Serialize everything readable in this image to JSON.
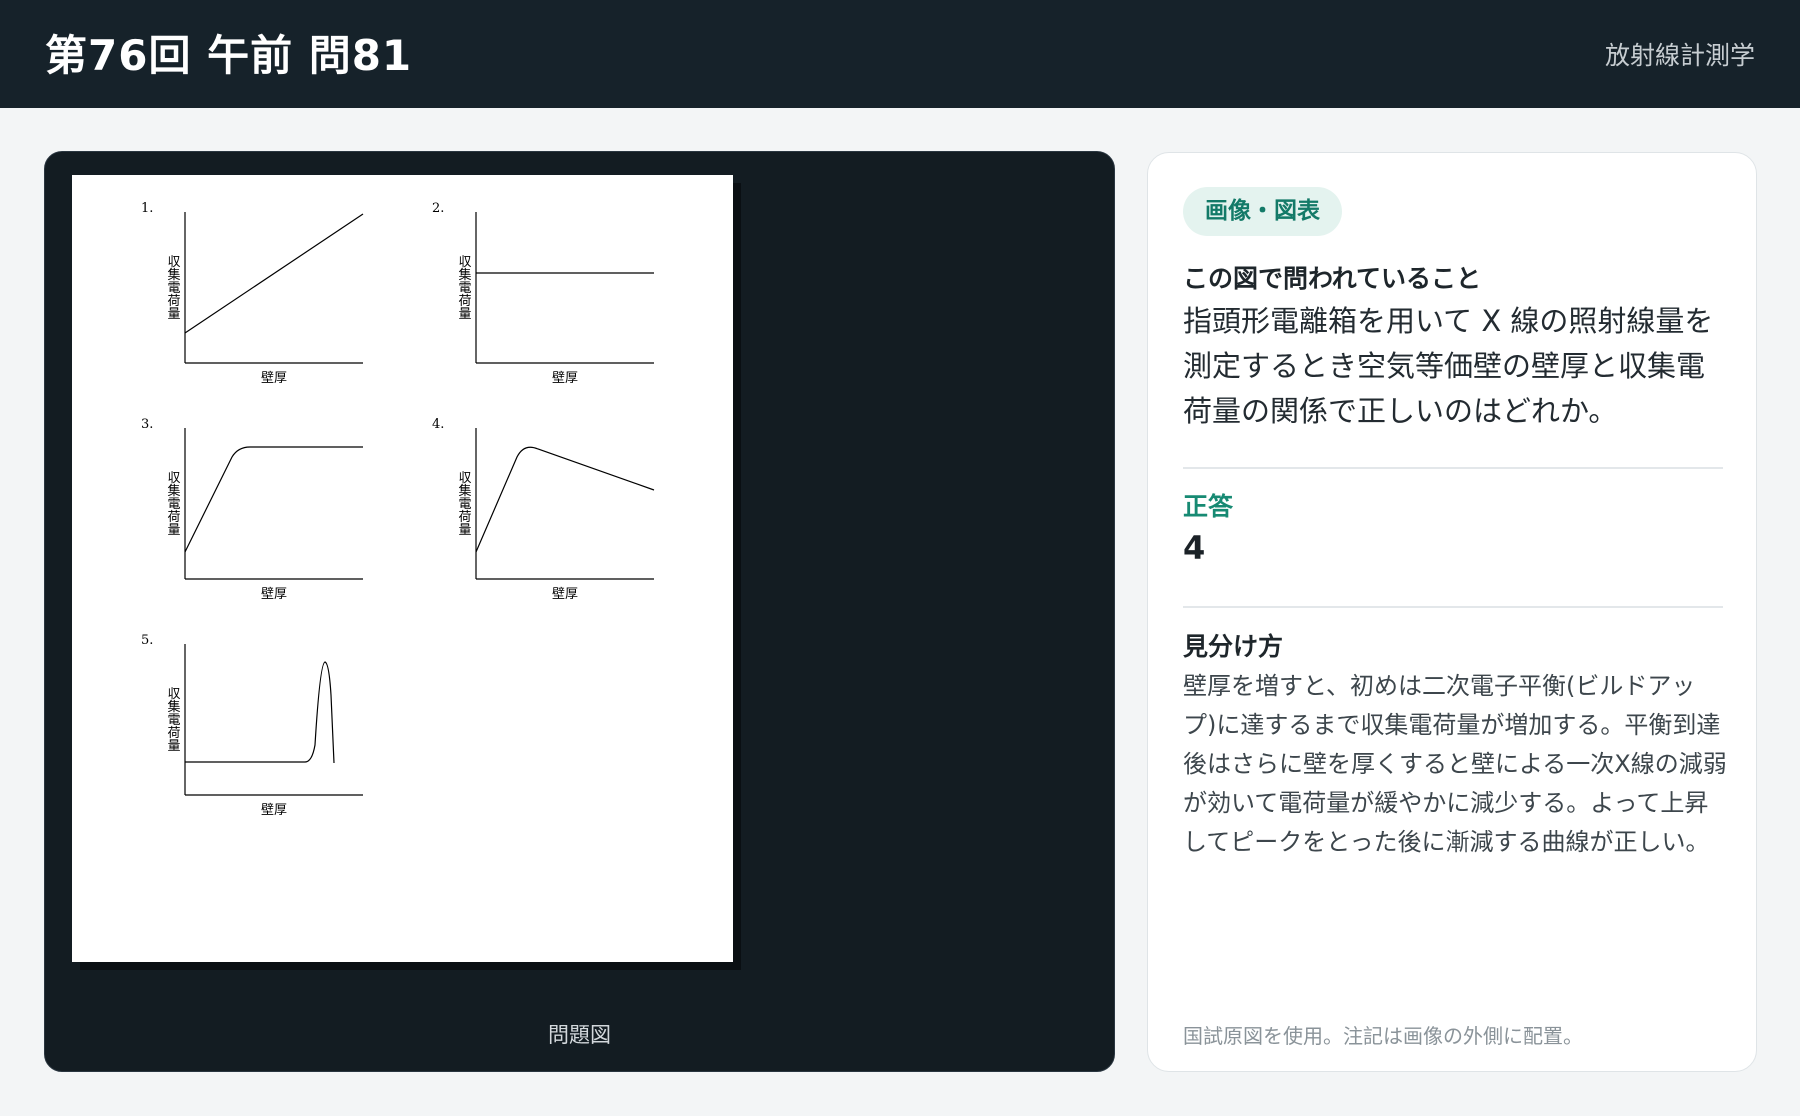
{
  "header": {
    "title": "第76回 午前 問81",
    "subject": "放射線計測学"
  },
  "figure": {
    "caption": "問題図",
    "graph_labels": {
      "ylabel": "収集電荷量",
      "xlabel": "壁厚"
    },
    "options": [
      "1.",
      "2.",
      "3.",
      "4.",
      "5."
    ]
  },
  "panel": {
    "tag": "画像・図表",
    "question_title": "この図で問われていること",
    "question_text": "指頭形電離箱を用いて X 線の照射線量を測定するとき空気等価壁の壁厚と収集電荷量の関係で正しいのはどれか。",
    "answer_label": "正答",
    "answer_value": "4",
    "explain_title": "見分け方",
    "explain_text": "壁厚を増すと、初めは二次電子平衡(ビルドアップ)に達するまで収集電荷量が増加する。平衡到達後はさらに壁を厚くすると壁による一次X線の減弱が効いて電荷量が緩やかに減少する。よって上昇してピークをとった後に漸減する曲線が正しい。",
    "note": "国試原図を使用。注記は画像の外側に配置。"
  },
  "colors": {
    "header_bg": "#16222a",
    "viewer_bg": "#131c22",
    "accent": "#178a73",
    "tag_bg": "#e4f3ef"
  }
}
